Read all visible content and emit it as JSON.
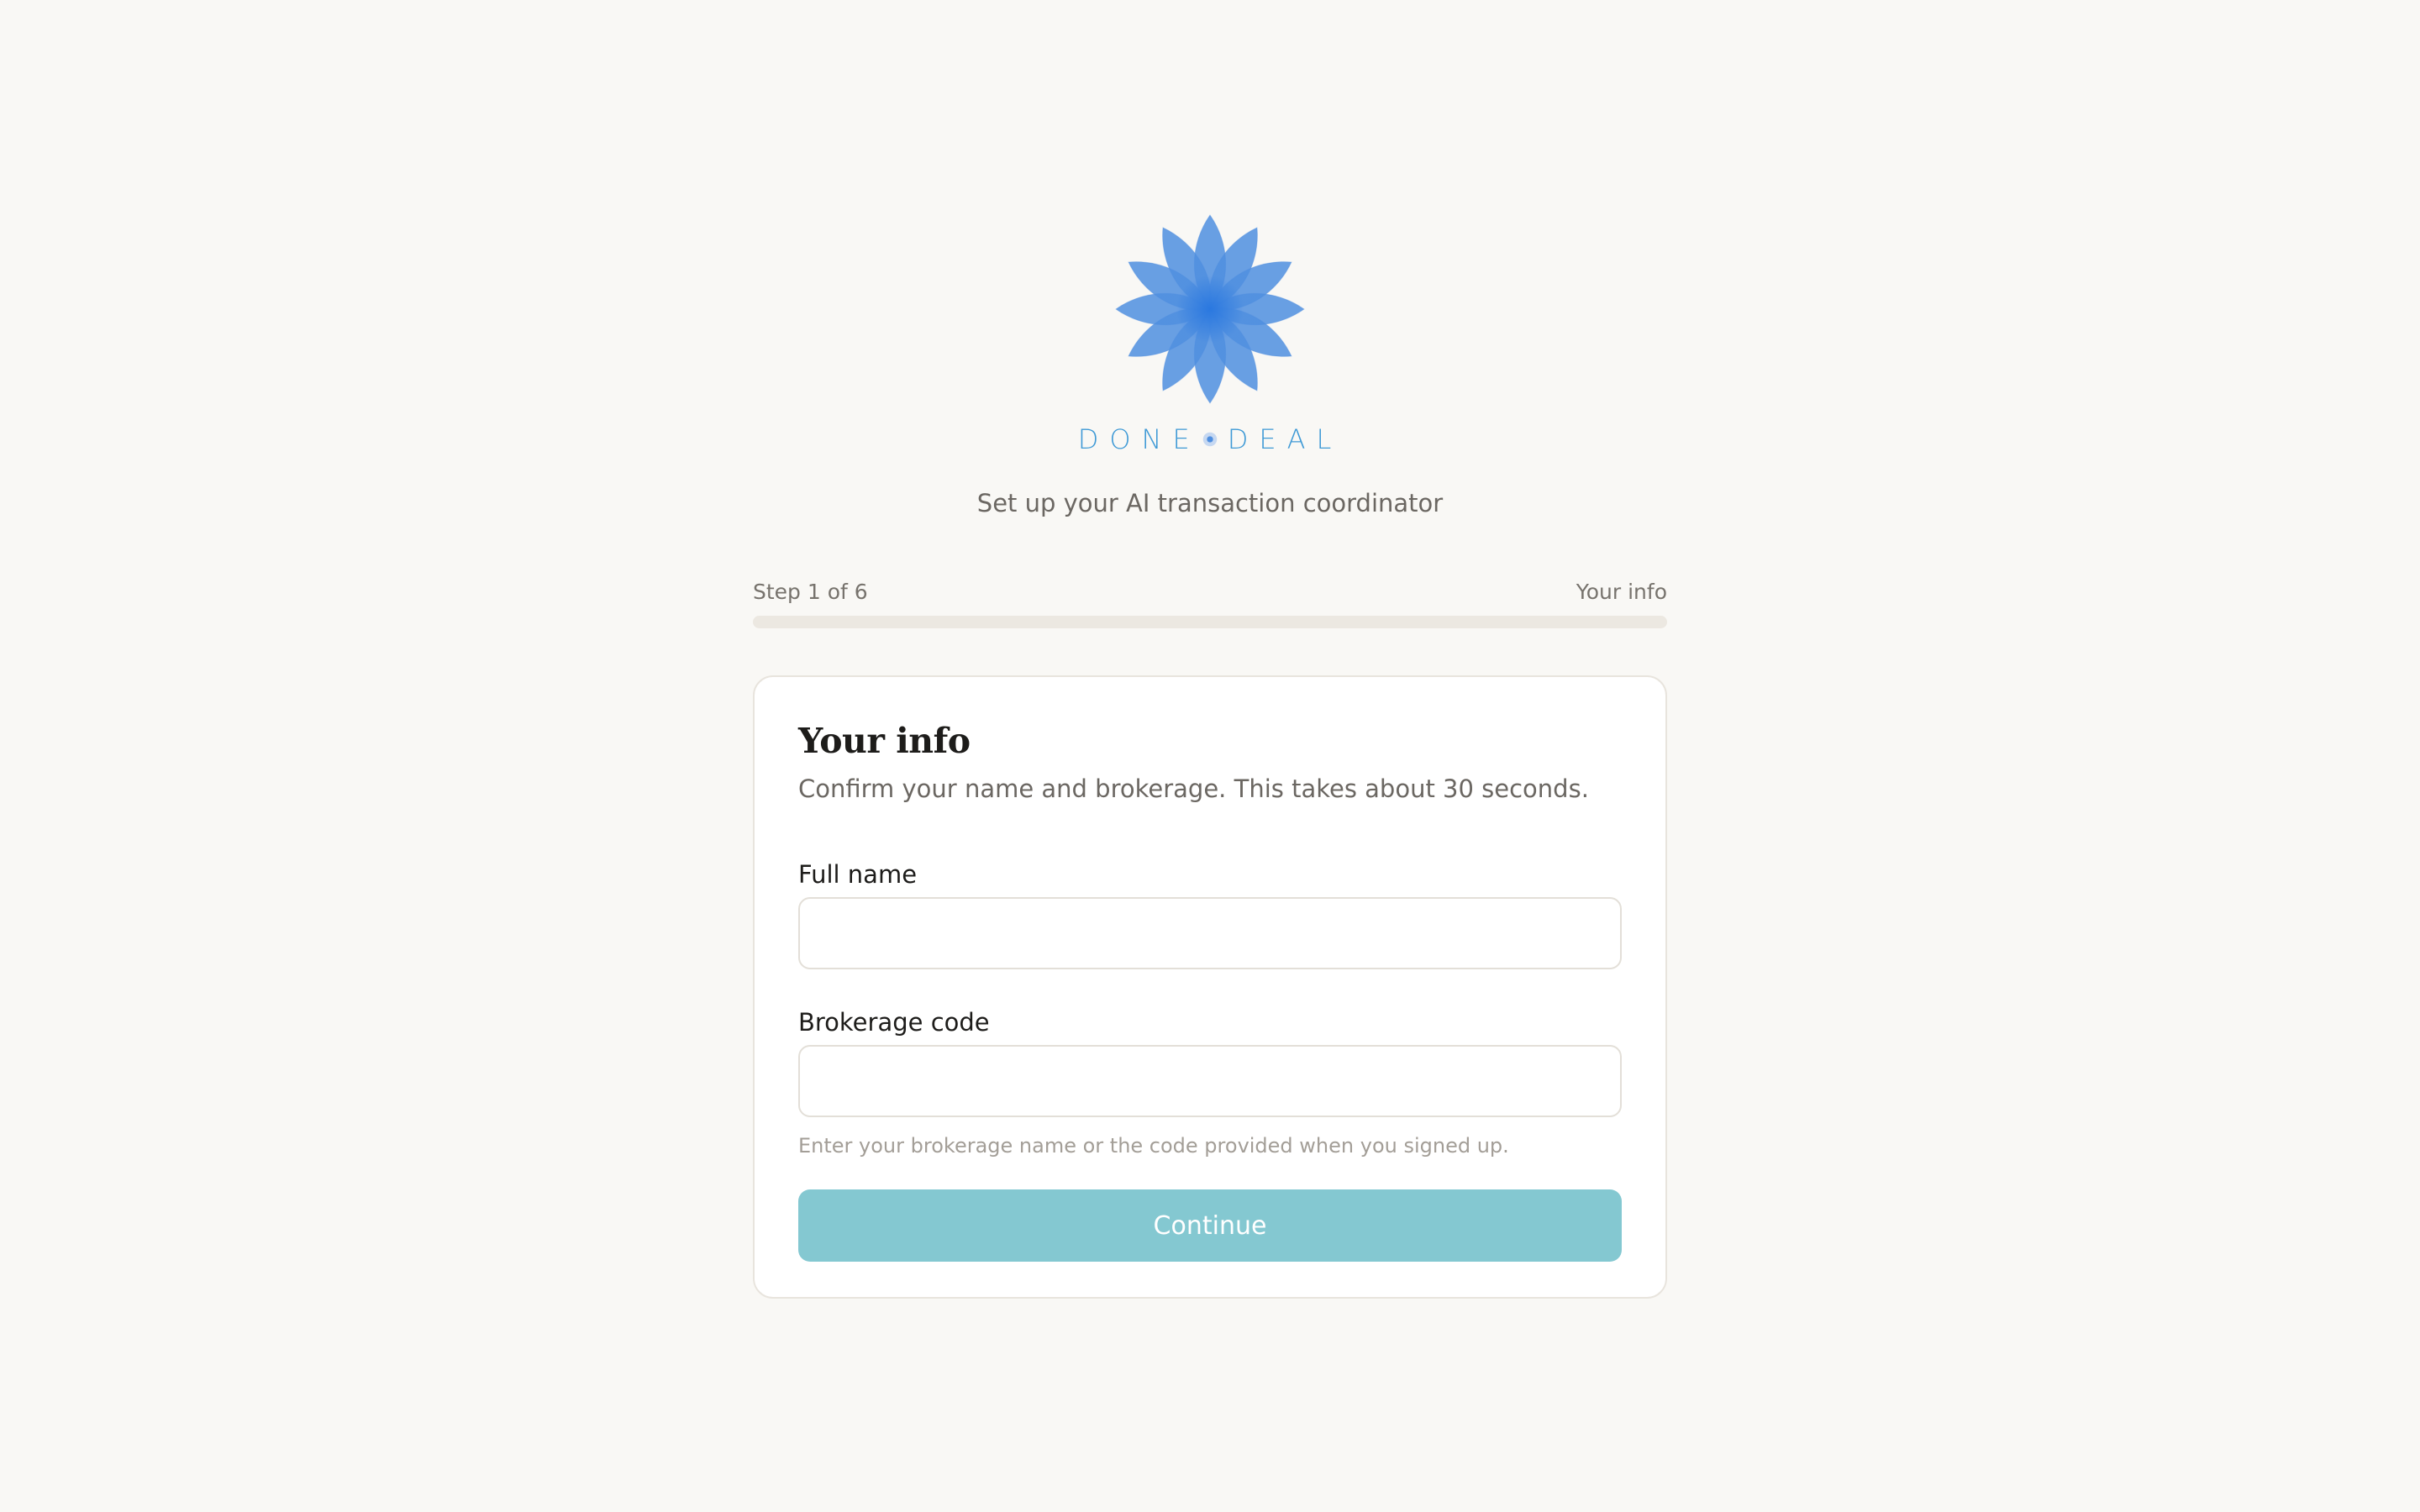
{
  "brand": {
    "wordmark_left": "DONE",
    "wordmark_right": "DEAL",
    "logo_icon": "lotus-flower-icon",
    "accent_color": "#3f9ad6"
  },
  "tagline": "Set up your AI transaction coordinator",
  "progress": {
    "step_label": "Step 1 of 6",
    "section_label": "Your info",
    "current_step": 1,
    "total_steps": 6
  },
  "card": {
    "title": "Your info",
    "subtitle": "Confirm your name and brokerage. This takes about 30 seconds.",
    "fields": {
      "full_name": {
        "label": "Full name",
        "value": "",
        "placeholder": ""
      },
      "brokerage_code": {
        "label": "Brokerage code",
        "value": "",
        "placeholder": "",
        "hint": "Enter your brokerage name or the code provided when you signed up."
      }
    },
    "continue_label": "Continue",
    "continue_color": "#84c8d1"
  }
}
